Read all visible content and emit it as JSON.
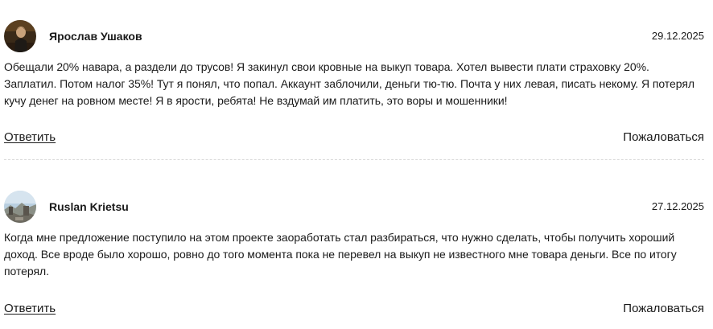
{
  "comments": [
    {
      "author": "Ярослав Ушаков",
      "date": "29.12.2025",
      "text": "Обещали 20% навара, а раздели до трусов! Я закинул свои кровные на выкуп товара. Хотел вывести плати страховку 20%. Заплатил. Потом налог 35%! Тут я понял, что попал. Аккаунт заблочили, деньги тю-тю. Почта у них левая, писать некому. Я потерял кучу денег на ровном месте! Я в ярости, ребята! Не вздумай им платить, это воры и мошенники!",
      "reply_label": "Ответить",
      "report_label": "Пожаловаться",
      "avatar_icon": "user-photo-avatar"
    },
    {
      "author": "Ruslan Krietsu",
      "date": "27.12.2025",
      "text": "Когда мне предложение поступило на этом проекте заоработать стал разбираться, что нужно сделать, чтобы получить хороший доход. Все вроде было хорошо, ровно до того момента пока не перевел на выкуп не известного мне товара деньги. Все по итогу потерял.",
      "reply_label": "Ответить",
      "report_label": "Пожаловаться",
      "avatar_icon": "user-photo-avatar"
    }
  ],
  "colors": {
    "text": "#1a1a1a",
    "divider": "#d9d9d9",
    "background": "#ffffff"
  }
}
